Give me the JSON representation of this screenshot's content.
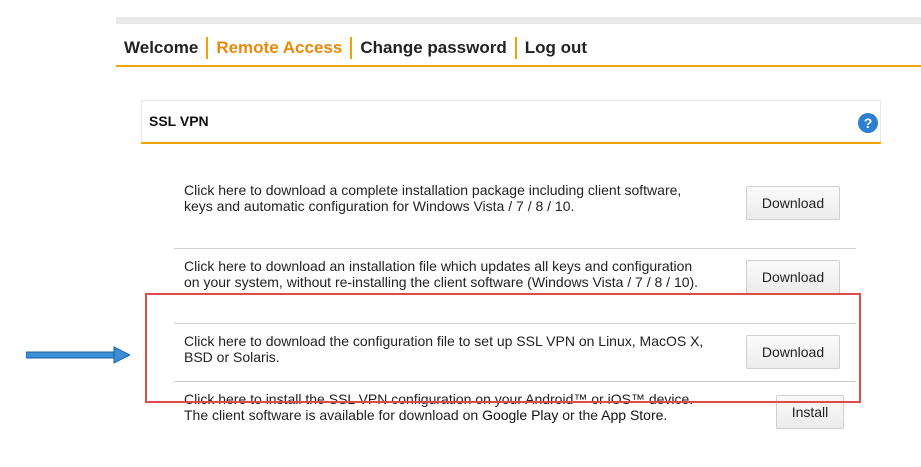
{
  "nav": {
    "items": [
      {
        "label": "Welcome",
        "active": false
      },
      {
        "label": "Remote Access",
        "active": true
      },
      {
        "label": "Change password",
        "active": false
      },
      {
        "label": "Log out",
        "active": false
      }
    ]
  },
  "panel": {
    "title": "SSL VPN",
    "help_icon": "?"
  },
  "rows": [
    {
      "text": "Click here to download a complete installation package including client software, keys and automatic configuration for Windows Vista / 7 / 8 / 10.",
      "button": "Download"
    },
    {
      "text": "Click here to download an installation file which updates all keys and configuration on your system, without re-installing the client software (Windows Vista / 7 / 8 / 10).",
      "button": "Download"
    },
    {
      "text": "Click here to download the configuration file to set up SSL VPN on Linux, MacOS X, BSD or Solaris.",
      "button": "Download"
    },
    {
      "text_before": "Click here to install the SSL VPN configuration on your Android™ or iOS™ device. The client software is available for download on ",
      "link1": "Google Play",
      "text_mid": " or the ",
      "link2": "App Store",
      "text_after": ".",
      "button": "Install"
    }
  ],
  "colors": {
    "accent": "#f0a400",
    "active_nav": "#e8890c",
    "highlight": "#e04a4a",
    "arrow": "#3a8fd6",
    "help": "#2f7fd0"
  }
}
